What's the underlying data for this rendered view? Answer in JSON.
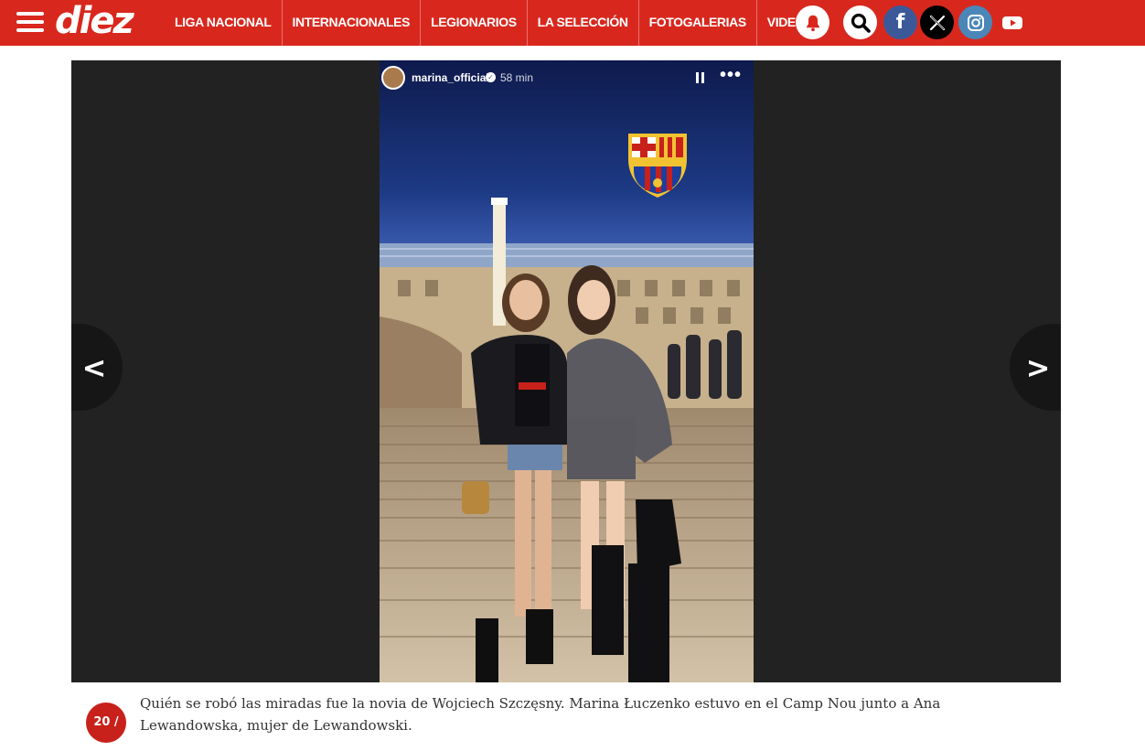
{
  "header": {
    "logo": "diez",
    "nav": [
      {
        "label": "LIGA NACIONAL"
      },
      {
        "label": "INTERNACIONALES"
      },
      {
        "label": "LEGIONARIOS"
      },
      {
        "label": "LA SELECCIÓN"
      },
      {
        "label": "FOTOGALERIAS"
      },
      {
        "label": "VIDEOS"
      }
    ],
    "icons": [
      "menu-icon",
      "bell-icon",
      "search-icon",
      "facebook-icon",
      "x-icon",
      "instagram-icon",
      "youtube-icon"
    ],
    "facebook_glyph": "f",
    "brand_color": "#d8281e"
  },
  "gallery": {
    "story": {
      "username": "marina_official",
      "time": "58 min",
      "verified_glyph": "✓",
      "more_glyph": "•••"
    },
    "prev_glyph": "<",
    "next_glyph": ">",
    "background": "#222222"
  },
  "caption": {
    "counter": "20 /",
    "text": "Quién se robó las miradas fue la novia de Wojciech Szczęsny. Marina Łuczenko estuvo en el Camp Nou junto a Ana Lewandowska, mujer de Lewandowski."
  }
}
